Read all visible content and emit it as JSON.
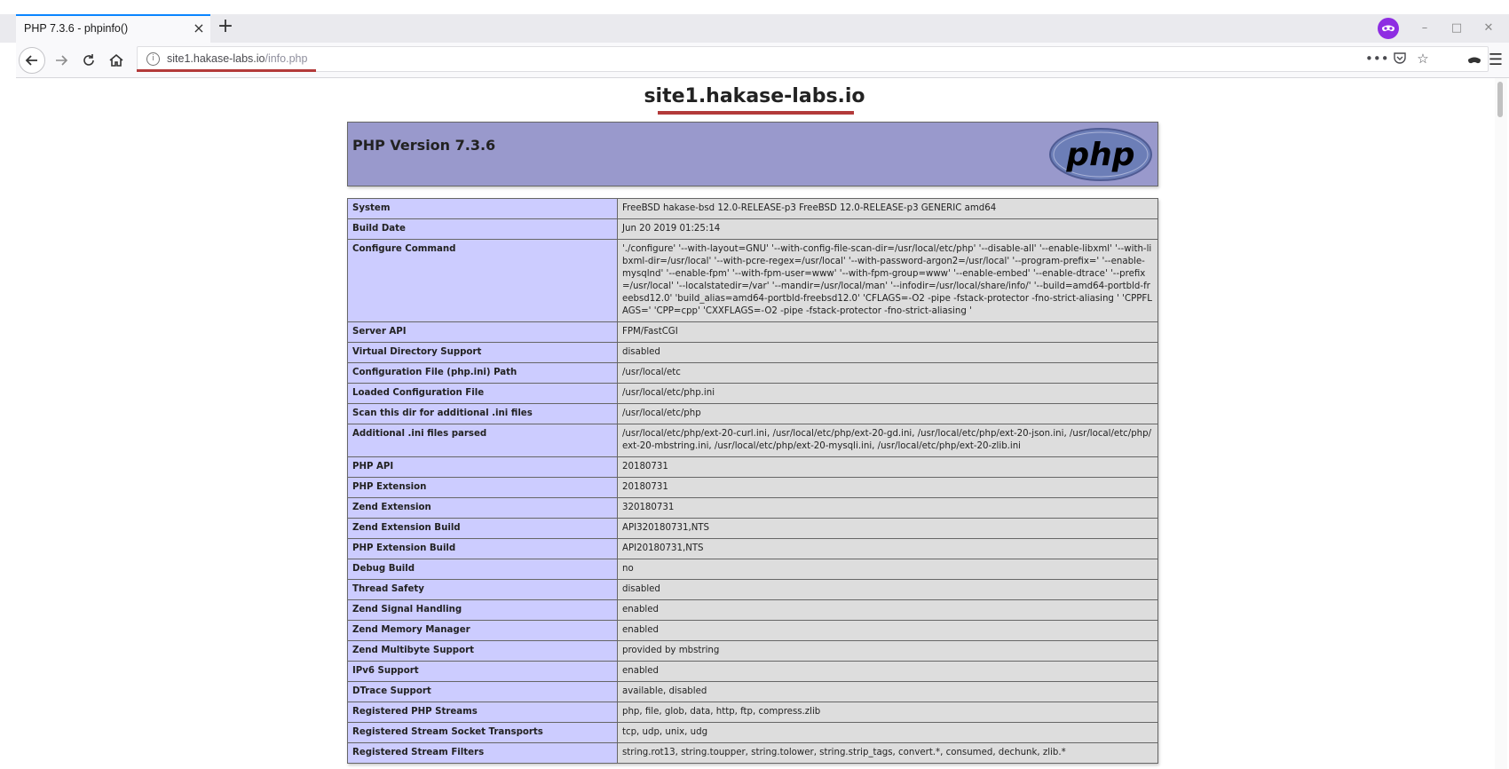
{
  "browser": {
    "tab_title": "PHP 7.3.6 - phpinfo()",
    "tab_close": "×",
    "new_tab": "+",
    "window_controls": {
      "minimize": "–",
      "maximize": "□",
      "close": "✕"
    },
    "url_host": "site1.hakase-labs.io",
    "url_path": "/info.php",
    "icons": [
      "back-icon",
      "forward-icon",
      "reload-icon",
      "home-icon",
      "info-icon",
      "page-actions-icon",
      "pocket-icon",
      "bookmark-star-icon",
      "private-mask-icon",
      "menu-icon"
    ]
  },
  "page": {
    "hostname": "site1.hakase-labs.io",
    "php_version": "PHP Version 7.3.6",
    "logo_text": "php",
    "rows": [
      {
        "key": "System",
        "value": "FreeBSD hakase-bsd 12.0-RELEASE-p3 FreeBSD 12.0-RELEASE-p3 GENERIC amd64"
      },
      {
        "key": "Build Date",
        "value": "Jun 20 2019 01:25:14"
      },
      {
        "key": "Configure Command",
        "value": "'./configure' '--with-layout=GNU' '--with-config-file-scan-dir=/usr/local/etc/php' '--disable-all' '--enable-libxml' '--with-libxml-dir=/usr/local' '--with-pcre-regex=/usr/local' '--with-password-argon2=/usr/local' '--program-prefix=' '--enable-mysqlnd' '--enable-fpm' '--with-fpm-user=www' '--with-fpm-group=www' '--enable-embed' '--enable-dtrace' '--prefix=/usr/local' '--localstatedir=/var' '--mandir=/usr/local/man' '--infodir=/usr/local/share/info/' '--build=amd64-portbld-freebsd12.0' 'build_alias=amd64-portbld-freebsd12.0' 'CFLAGS=-O2 -pipe -fstack-protector -fno-strict-aliasing ' 'CPPFLAGS=' 'CPP=cpp' 'CXXFLAGS=-O2 -pipe -fstack-protector -fno-strict-aliasing '"
      },
      {
        "key": "Server API",
        "value": "FPM/FastCGI"
      },
      {
        "key": "Virtual Directory Support",
        "value": "disabled"
      },
      {
        "key": "Configuration File (php.ini) Path",
        "value": "/usr/local/etc"
      },
      {
        "key": "Loaded Configuration File",
        "value": "/usr/local/etc/php.ini"
      },
      {
        "key": "Scan this dir for additional .ini files",
        "value": "/usr/local/etc/php"
      },
      {
        "key": "Additional .ini files parsed",
        "value": "/usr/local/etc/php/ext-20-curl.ini, /usr/local/etc/php/ext-20-gd.ini, /usr/local/etc/php/ext-20-json.ini, /usr/local/etc/php/ext-20-mbstring.ini, /usr/local/etc/php/ext-20-mysqli.ini, /usr/local/etc/php/ext-20-zlib.ini"
      },
      {
        "key": "PHP API",
        "value": "20180731"
      },
      {
        "key": "PHP Extension",
        "value": "20180731"
      },
      {
        "key": "Zend Extension",
        "value": "320180731"
      },
      {
        "key": "Zend Extension Build",
        "value": "API320180731,NTS"
      },
      {
        "key": "PHP Extension Build",
        "value": "API20180731,NTS"
      },
      {
        "key": "Debug Build",
        "value": "no"
      },
      {
        "key": "Thread Safety",
        "value": "disabled"
      },
      {
        "key": "Zend Signal Handling",
        "value": "enabled"
      },
      {
        "key": "Zend Memory Manager",
        "value": "enabled"
      },
      {
        "key": "Zend Multibyte Support",
        "value": "provided by mbstring"
      },
      {
        "key": "IPv6 Support",
        "value": "enabled"
      },
      {
        "key": "DTrace Support",
        "value": "available, disabled"
      },
      {
        "key": "Registered PHP Streams",
        "value": "php, file, glob, data, http, ftp, compress.zlib"
      },
      {
        "key": "Registered Stream Socket Transports",
        "value": "tcp, udp, unix, udg"
      },
      {
        "key": "Registered Stream Filters",
        "value": "string.rot13, string.toupper, string.tolower, string.strip_tags, convert.*, consumed, dechunk, zlib.*"
      }
    ]
  },
  "colors": {
    "header_bg": "#9999cc",
    "key_bg": "#ccccff",
    "value_bg": "#dddddd",
    "annotation_red": "#b33a3a",
    "tab_accent": "#0a84ff"
  }
}
